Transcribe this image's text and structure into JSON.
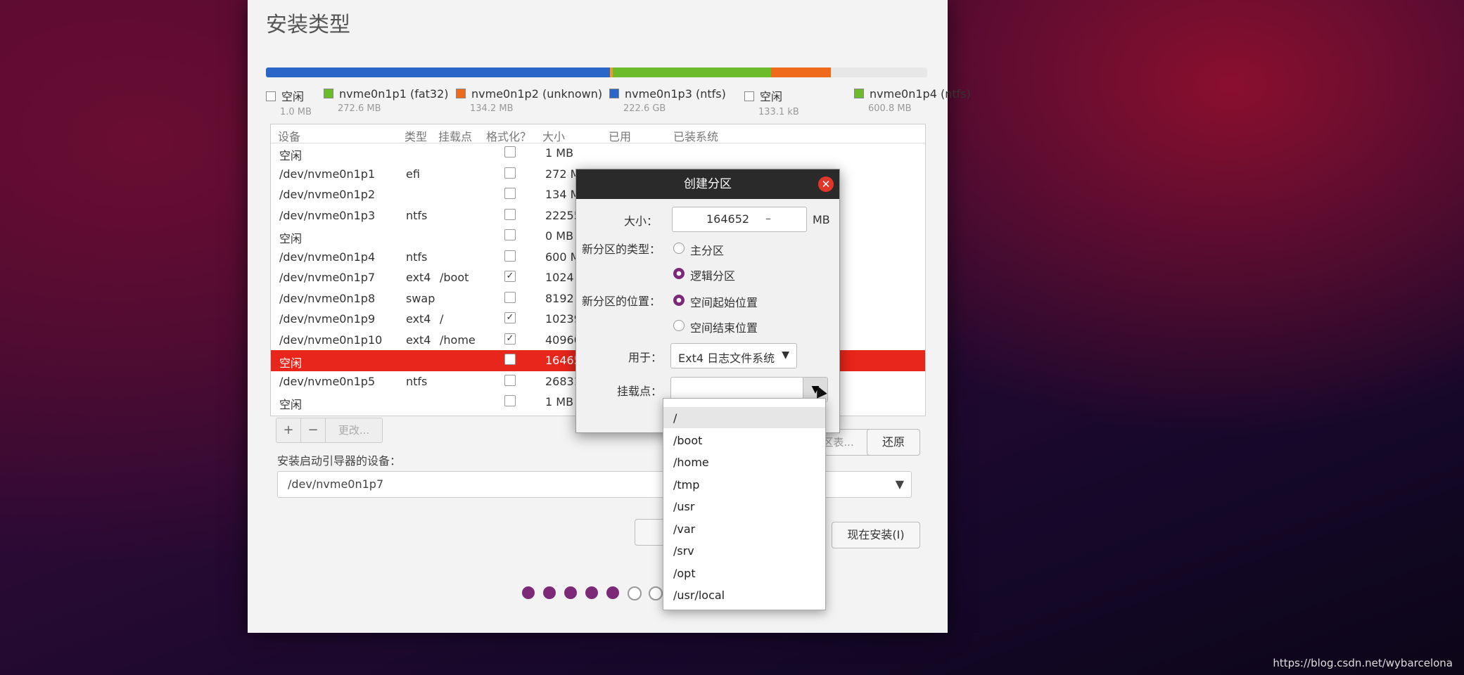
{
  "window_title": "安装类型",
  "partition_bar": [
    {
      "color": "#2a66c8",
      "fraction": 0.52
    },
    {
      "color": "#f39a20",
      "fraction": 0.004
    },
    {
      "color": "#6bbb2a",
      "fraction": 0.24
    },
    {
      "color": "#ef6a1a",
      "fraction": 0.09
    },
    {
      "color": "#e7e7e7",
      "fraction": 0.146
    }
  ],
  "legend": [
    {
      "label": "空闲",
      "size": "1.0 MB",
      "color": "#ffffff"
    },
    {
      "label": "nvme0n1p1 (fat32)",
      "size": "272.6 MB",
      "color": "#6bbb2a"
    },
    {
      "label": "nvme0n1p2 (unknown)",
      "size": "134.2 MB",
      "color": "#ef6a1a"
    },
    {
      "label": "nvme0n1p3 (ntfs)",
      "size": "222.6 GB",
      "color": "#2a66c8"
    },
    {
      "label": "空闲",
      "size": "133.1 kB",
      "color": "#ffffff"
    },
    {
      "label": "nvme0n1p4 (ntfs)",
      "size": "600.8 MB",
      "color": "#6bbb2a"
    }
  ],
  "table": {
    "headers": {
      "device": "设备",
      "type": "类型",
      "mount": "挂载点",
      "format": "格式化？",
      "size": "大小",
      "used": "已用",
      "installed": "已装系统"
    },
    "rows": [
      {
        "device": "空闲",
        "type": "",
        "mount": "",
        "format": "",
        "size": "1 MB"
      },
      {
        "device": "/dev/nvme0n1p1",
        "type": "efi",
        "mount": "",
        "format": "",
        "size": "272 MB"
      },
      {
        "device": "/dev/nvme0n1p2",
        "type": "",
        "mount": "",
        "format": "",
        "size": "134 MB"
      },
      {
        "device": "/dev/nvme0n1p3",
        "type": "ntfs",
        "mount": "",
        "format": "",
        "size": "222552"
      },
      {
        "device": "空闲",
        "type": "",
        "mount": "",
        "format": "",
        "size": "0 MB"
      },
      {
        "device": "/dev/nvme0n1p4",
        "type": "ntfs",
        "mount": "",
        "format": "",
        "size": "600 MB"
      },
      {
        "device": "/dev/nvme0n1p7",
        "type": "ext4",
        "mount": "/boot",
        "format": "✓",
        "size": "1024 MB"
      },
      {
        "device": "/dev/nvme0n1p8",
        "type": "swap",
        "mount": "",
        "format": "",
        "size": "8192 MB"
      },
      {
        "device": "/dev/nvme0n1p9",
        "type": "ext4",
        "mount": "/",
        "format": "✓",
        "size": "102399"
      },
      {
        "device": "/dev/nvme0n1p10",
        "type": "ext4",
        "mount": "/home",
        "format": "✓",
        "size": "40960"
      },
      {
        "device": "空闲",
        "type": "",
        "mount": "",
        "format": "",
        "size": "164652",
        "selected": true
      },
      {
        "device": "/dev/nvme0n1p5",
        "type": "ntfs",
        "mount": "",
        "format": "",
        "size": "268315"
      },
      {
        "device": "空闲",
        "type": "",
        "mount": "",
        "format": "",
        "size": "1 MB"
      }
    ]
  },
  "tools": {
    "add": "+",
    "remove": "−",
    "change": "更改..."
  },
  "bootloader": {
    "label": "安装启动引导器的设备：",
    "value": "/dev/nvme0n1p7"
  },
  "buttons": {
    "new_table": "新建分区表...",
    "revert": "还原",
    "back": "退",
    "install": "现在安装(I)"
  },
  "dialog": {
    "title": "创建分区",
    "size_label": "大小：",
    "size_value": "164652",
    "size_minus": "–",
    "size_unit": "MB",
    "type_label": "新分区的类型：",
    "type_primary": "主分区",
    "type_logical": "逻辑分区",
    "location_label": "新分区的位置：",
    "location_start": "空间起始位置",
    "location_end": "空间结束位置",
    "use_label": "用于：",
    "use_value": "Ext4 日志文件系统",
    "mount_label": "挂载点："
  },
  "mount_options": [
    "/",
    "/boot",
    "/home",
    "/tmp",
    "/usr",
    "/var",
    "/srv",
    "/opt",
    "/usr/local"
  ],
  "steps": [
    true,
    true,
    true,
    true,
    true,
    false,
    false
  ],
  "watermark": "https://blog.csdn.net/wybarcelona"
}
